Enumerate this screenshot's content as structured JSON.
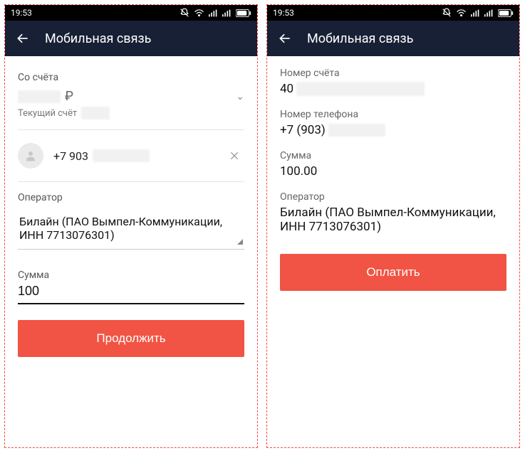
{
  "statusbar": {
    "time": "19:53"
  },
  "appbar": {
    "title": "Мобильная связь"
  },
  "left": {
    "from_account_label": "Со счёта",
    "currency_symbol": "₽",
    "current_account_label": "Текущий счёт",
    "phone_prefix": "+7 903",
    "operator_label": "Оператор",
    "operator_value": "Билайн (ПАО Вымпел-Коммуникации, ИНН 7713076301)",
    "amount_label": "Сумма",
    "amount_value": "100",
    "continue_label": "Продолжить"
  },
  "right": {
    "account_number_label": "Номер счёта",
    "account_number_prefix": "40",
    "phone_label": "Номер телефона",
    "phone_prefix": "+7 (903)",
    "amount_label": "Сумма",
    "amount_value": "100.00",
    "operator_label": "Оператор",
    "operator_value": "Билайн (ПАО Вымпел-Коммуникации, ИНН 7713076301)",
    "pay_label": "Оплатить"
  }
}
